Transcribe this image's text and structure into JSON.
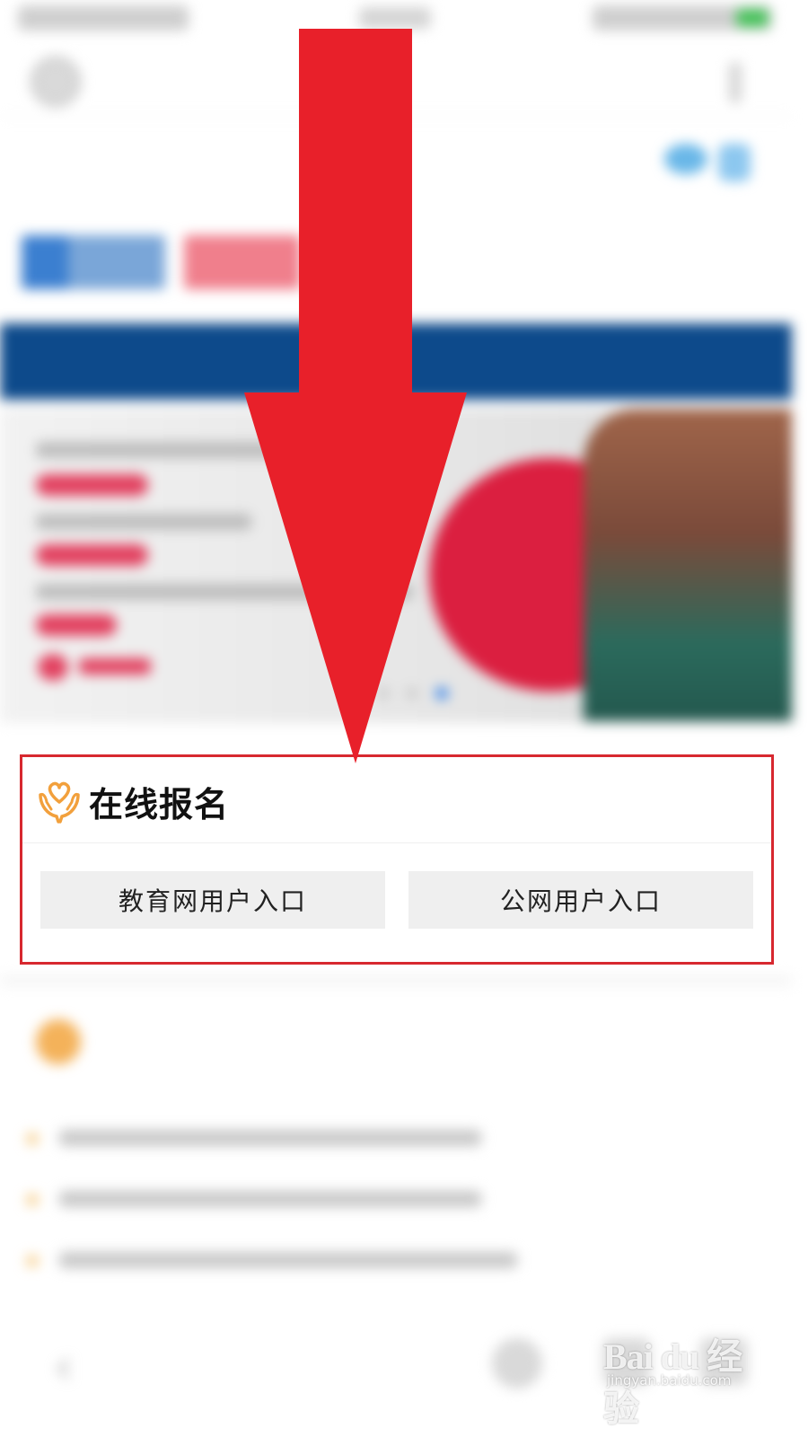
{
  "signup": {
    "title": "在线报名",
    "heart_icon": "heart-hands-icon",
    "buttons": [
      {
        "label": "教育网用户入口"
      },
      {
        "label": "公网用户入口"
      }
    ]
  },
  "watermark": {
    "brand": "Bai du 经验",
    "url": "jingyan.baidu.com"
  },
  "colors": {
    "highlight_border": "#d7282f",
    "arrow": "#e8202a",
    "nav_bar": "#0d4a8b",
    "icon_accent": "#f2a03c",
    "button_bg": "#efefef"
  },
  "annotation": {
    "arrow_icon": "down-arrow-icon"
  }
}
